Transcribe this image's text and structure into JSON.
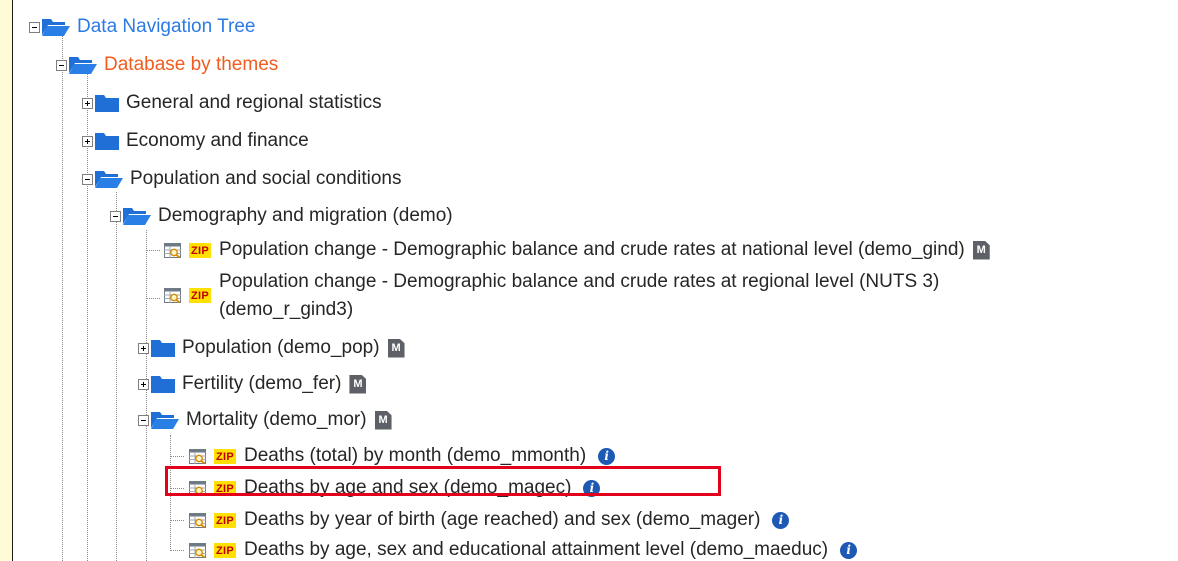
{
  "tree": {
    "root": {
      "label": "Data Navigation Tree",
      "color": "#2c7be5"
    },
    "themes": {
      "label": "Database by themes",
      "color": "#f25c1e"
    },
    "general": {
      "label": "General and regional statistics"
    },
    "economy": {
      "label": "Economy and finance"
    },
    "population_social": {
      "label": "Population and social conditions"
    },
    "demography": {
      "label": "Demography and migration (demo)"
    },
    "pop_change_national": {
      "label": "Population change - Demographic balance and crude rates at national level (demo_gind)",
      "zip": "ZIP",
      "metadata": "M"
    },
    "pop_change_regional": {
      "label_line1": "Population change - Demographic balance and crude rates at regional level (NUTS 3)",
      "label_line2": "(demo_r_gind3)",
      "zip": "ZIP"
    },
    "population": {
      "label": "Population (demo_pop)",
      "metadata": "M"
    },
    "fertility": {
      "label": "Fertility (demo_fer)",
      "metadata": "M"
    },
    "mortality": {
      "label": "Mortality (demo_mor)",
      "metadata": "M"
    },
    "deaths_month": {
      "label": "Deaths (total) by month (demo_mmonth)",
      "zip": "ZIP",
      "info": "i"
    },
    "deaths_age_sex": {
      "label": "Deaths by age and sex (demo_magec)",
      "zip": "ZIP",
      "info": "i"
    },
    "deaths_birth_year": {
      "label": "Deaths by year of birth (age reached) and sex (demo_mager)",
      "zip": "ZIP",
      "info": "i"
    },
    "deaths_education": {
      "label": "Deaths by age, sex and educational attainment level (demo_maeduc)",
      "zip": "ZIP",
      "info": "i"
    }
  },
  "icons": {
    "folder_color": "#1f6fd6",
    "expand": "plus-icon",
    "collapse": "minus-icon",
    "dataset": "table-search-icon",
    "zip": "zip-icon",
    "metadata": "metadata-icon",
    "info": "info-icon"
  },
  "highlight_color": "#e3001b"
}
